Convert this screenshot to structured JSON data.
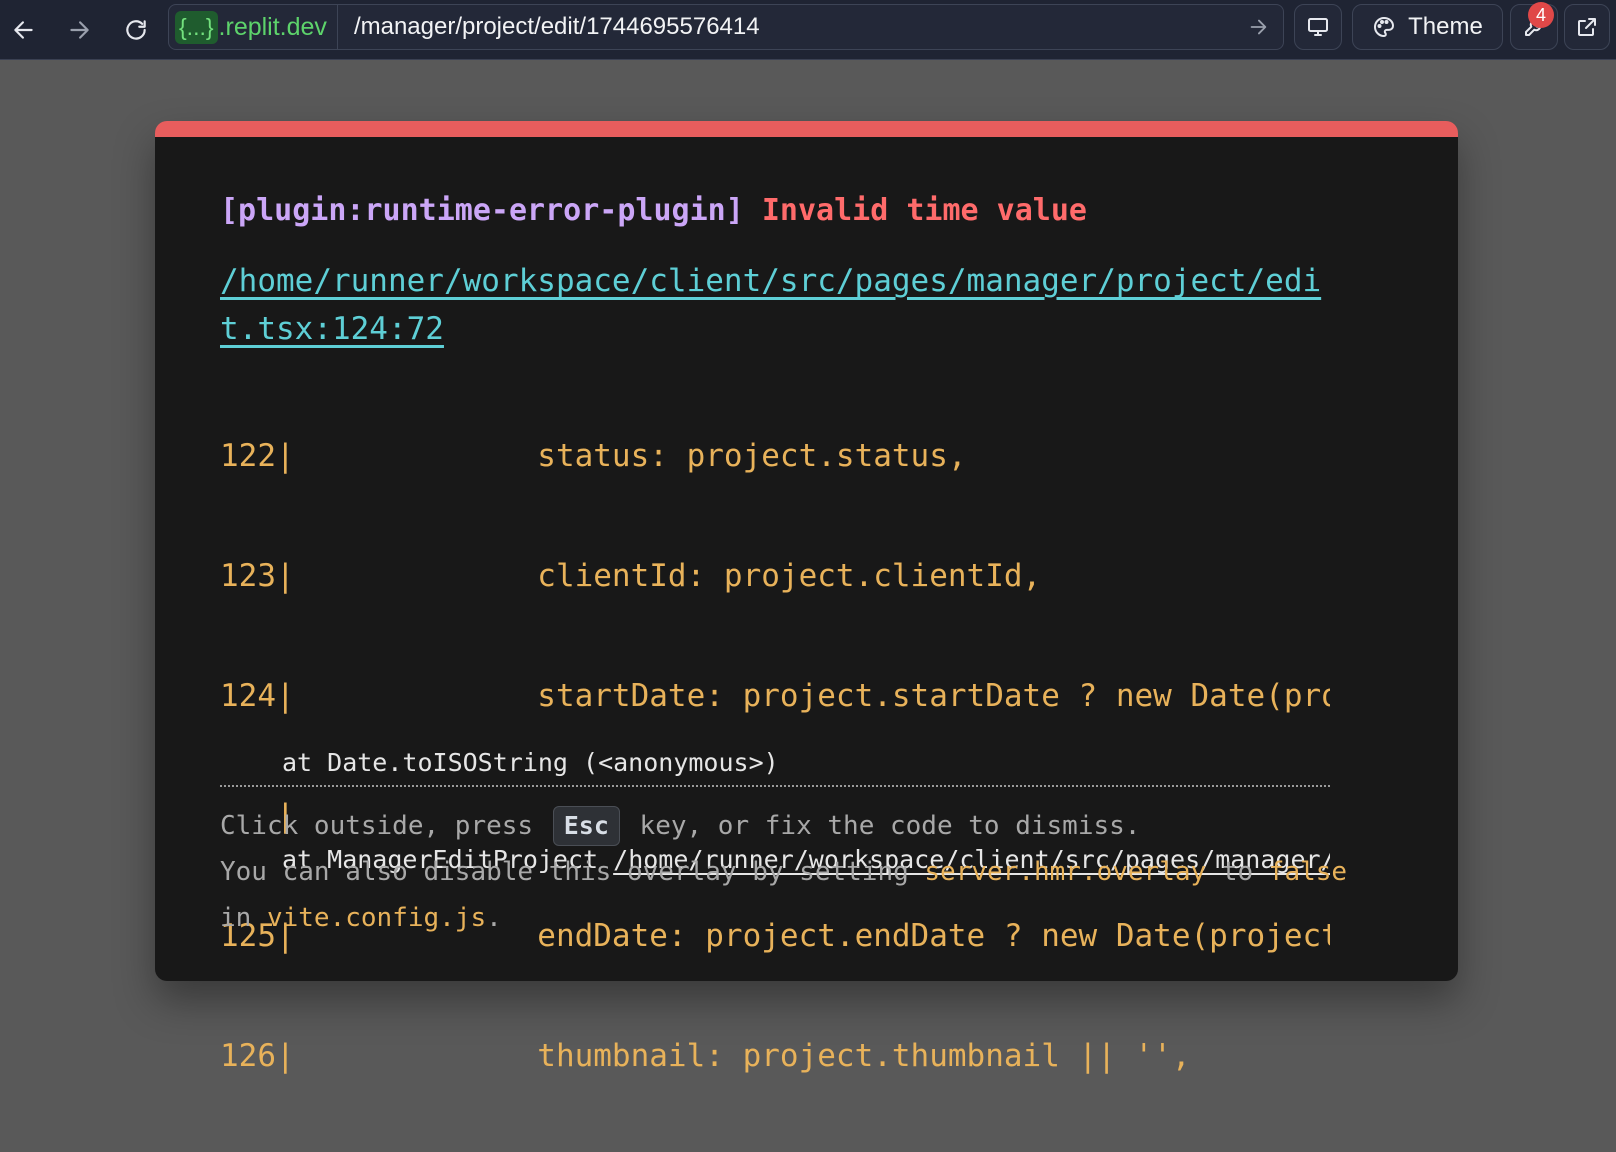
{
  "browser": {
    "domain_badge": "{...}",
    "domain": ".replit.dev",
    "url_path": "/manager/project/edit/1744695576414",
    "theme_label": "Theme",
    "notifications_count": "4"
  },
  "overlay": {
    "plugin": "[plugin:runtime-error-plugin]",
    "message": "Invalid time value",
    "file_location": "/home/runner/workspace/client/src/pages/manager/project/edit.tsx:124:72",
    "code_frame": [
      {
        "gutter": "122|",
        "code": "             status: project.status,"
      },
      {
        "gutter": "123|",
        "code": "             clientId: project.clientId,"
      },
      {
        "gutter": "124|",
        "code": "             startDate: project.startDate ? new Date(pro"
      },
      {
        "gutter": "   |",
        "code": ""
      },
      {
        "gutter": "125|",
        "code": "             endDate: project.endDate ? new Date(project"
      },
      {
        "gutter": "126|",
        "code": "             thumbnail: project.thumbnail || '',"
      }
    ],
    "stack": {
      "line1": "at Date.toISOString (<anonymous>)",
      "line2_prefix": "at ManagerEditProject ",
      "line2_link": "/home/runner/workspace/client/src/pages/manager/p"
    },
    "tip": {
      "part1": "Click outside, press ",
      "key": "Esc",
      "part2": " key, or fix the code to dismiss.",
      "part3": "You can also disable this overlay by setting ",
      "setting": "server.hmr.overlay",
      "part4": " to ",
      "value": "false",
      "part5": "in ",
      "config": "vite.config.js",
      "part6": "."
    }
  },
  "colors": {
    "accent_error": "#e85d5d",
    "plugin_purple": "#cba6f7",
    "link_cyan": "#5ecfd6",
    "code_orange": "#e8b25a"
  },
  "icons": [
    "back-arrow-icon",
    "forward-arrow-icon",
    "reload-icon",
    "go-arrow-icon",
    "monitor-icon",
    "palette-icon",
    "wrench-icon",
    "external-link-icon"
  ]
}
